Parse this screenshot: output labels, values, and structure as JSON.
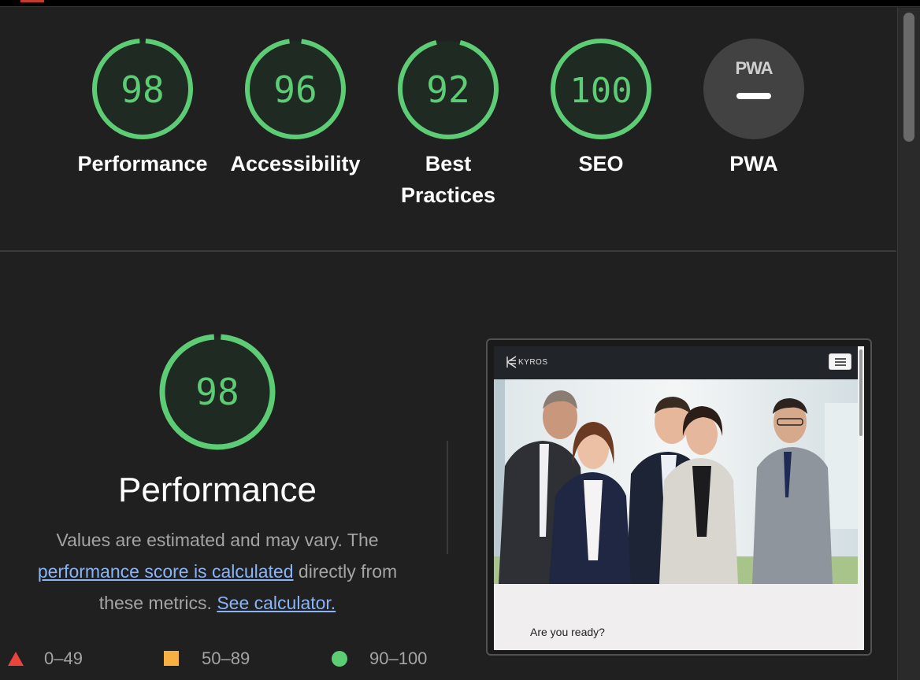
{
  "categories": [
    {
      "id": "performance",
      "score": "98",
      "label": "Performance"
    },
    {
      "id": "accessibility",
      "score": "96",
      "label": "Accessibility"
    },
    {
      "id": "best-practices",
      "score": "92",
      "label": "Best Practices"
    },
    {
      "id": "seo",
      "score": "100",
      "label": "SEO"
    },
    {
      "id": "pwa",
      "badge_text": "PWA",
      "label": "PWA"
    }
  ],
  "performance_section": {
    "score": "98",
    "title": "Performance",
    "desc_part1": "Values are estimated and may vary. The",
    "desc_link1": "performance score is calculated",
    "desc_part2": "directly from these metrics.",
    "desc_link2": "See calculator."
  },
  "legend": [
    {
      "range": "0–49",
      "shape": "triangle",
      "color": "#e8453c"
    },
    {
      "range": "50–89",
      "shape": "square",
      "color": "#f9b043"
    },
    {
      "range": "90–100",
      "shape": "circle",
      "color": "#5ccd74"
    }
  ],
  "preview": {
    "logo_text": "KYROS",
    "body_text": "Are you ready?"
  },
  "colors": {
    "pass": "#5ccd74",
    "background": "#202020",
    "link": "#8ab4f8",
    "text_muted": "#a4a4a4"
  }
}
